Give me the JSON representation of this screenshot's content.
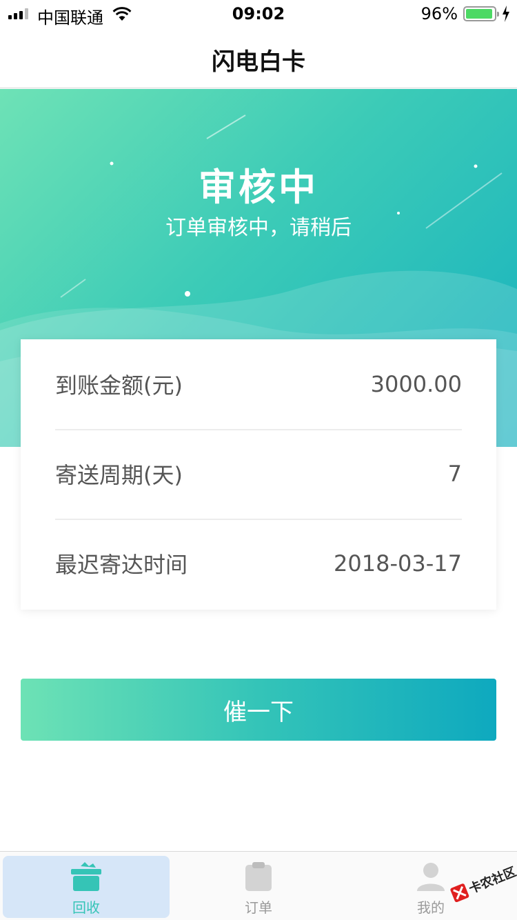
{
  "status_bar": {
    "carrier": "中国联通",
    "time": "09:02",
    "battery_percent": "96%",
    "battery_level": 0.96
  },
  "nav": {
    "title": "闪电白卡"
  },
  "hero": {
    "title": "审核中",
    "subtitle": "订单审核中，请稍后"
  },
  "info": {
    "rows": [
      {
        "label": "到账金额(元)",
        "value": "3000.00"
      },
      {
        "label": "寄送周期(天)",
        "value": "7"
      },
      {
        "label": "最迟寄达时间",
        "value": "2018-03-17"
      }
    ]
  },
  "actions": {
    "urge_label": "催一下"
  },
  "tabs": [
    {
      "label": "回收",
      "icon": "gift-icon",
      "active": true
    },
    {
      "label": "订单",
      "icon": "clipboard-icon",
      "active": false
    },
    {
      "label": "我的",
      "icon": "user-icon",
      "active": false
    }
  ],
  "watermark": {
    "text": "卡农社区"
  },
  "colors": {
    "accent": "#35c4b6",
    "gradient_start": "#6ee2b6",
    "gradient_end": "#0ea9bf",
    "active_tab_bg": "#d6e6f8"
  }
}
